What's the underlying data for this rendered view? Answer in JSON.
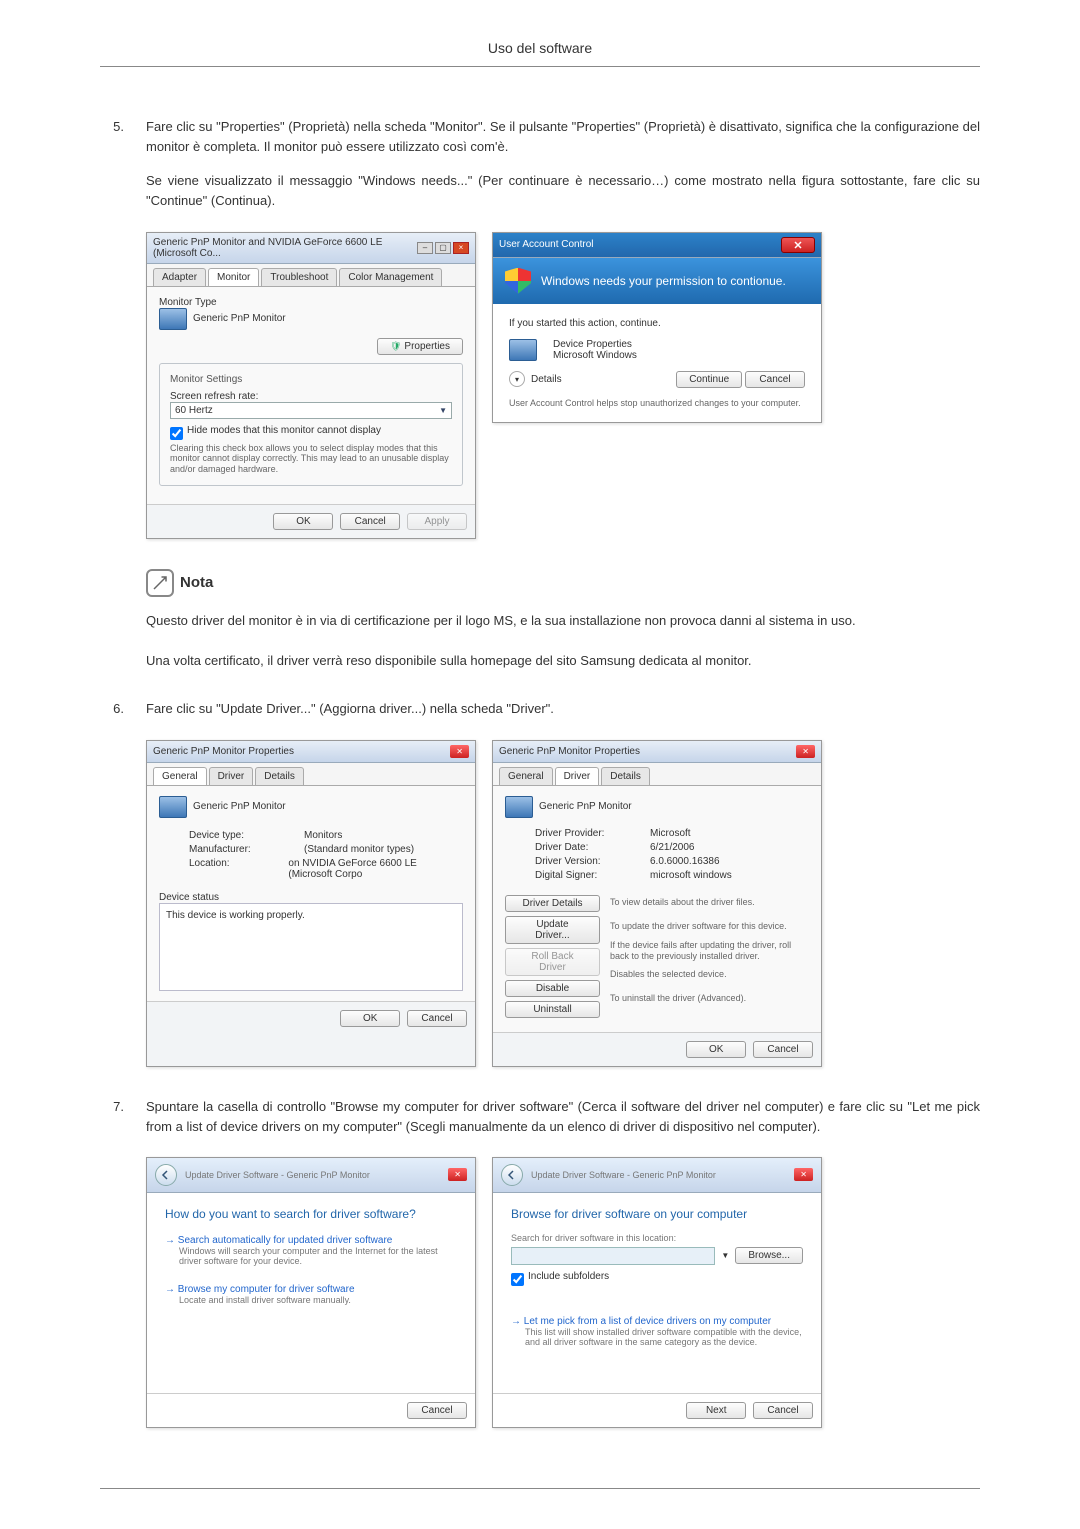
{
  "header": {
    "title": "Uso del software"
  },
  "steps": {
    "s5": {
      "num": "5.",
      "p1": "Fare clic su \"Properties\" (Proprietà) nella scheda \"Monitor\". Se il pulsante \"Properties\" (Proprietà) è disattivato, significa che la configurazione del monitor è completa. Il monitor può essere utilizzato così com'è.",
      "p2": "Se viene visualizzato il messaggio \"Windows needs...\" (Per continuare è necessario…) come mostrato nella figura sottostante, fare clic su \"Continue\" (Continua)."
    },
    "s6": {
      "num": "6.",
      "p1": "Fare clic su \"Update Driver...\" (Aggiorna driver...) nella scheda \"Driver\"."
    },
    "s7": {
      "num": "7.",
      "p1": "Spuntare la casella di controllo \"Browse my computer for driver software\" (Cerca il software del driver nel computer) e fare clic su \"Let me pick from a list of device drivers on my computer\" (Scegli manualmente da un elenco di driver di dispositivo nel computer)."
    }
  },
  "note": {
    "label": "Nota",
    "p1": "Questo driver del monitor è in via di certificazione per il logo MS, e la sua installazione non provoca danni al sistema in uso.",
    "p2": "Una volta certificato, il driver verrà reso disponibile sulla homepage del sito Samsung dedicata al monitor."
  },
  "win5a": {
    "title": "Generic PnP Monitor and NVIDIA GeForce 6600 LE (Microsoft Co...",
    "tabs": [
      "Adapter",
      "Monitor",
      "Troubleshoot",
      "Color Management"
    ],
    "monitorType": "Monitor Type",
    "monitorName": "Generic PnP Monitor",
    "properties": "Properties",
    "settings": "Monitor Settings",
    "refreshLabel": "Screen refresh rate:",
    "refreshValue": "60 Hertz",
    "hide": "Hide modes that this monitor cannot display",
    "hideHelp": "Clearing this check box allows you to select display modes that this monitor cannot display correctly. This may lead to an unusable display and/or damaged hardware.",
    "ok": "OK",
    "cancel": "Cancel",
    "apply": "Apply"
  },
  "uac": {
    "title": "User Account Control",
    "message": "Windows needs your permission to contionue.",
    "started": "If you started this action, continue.",
    "devProps": "Device Properties",
    "msWin": "Microsoft Windows",
    "details": "Details",
    "continue": "Continue",
    "cancel": "Cancel",
    "footer": "User Account Control helps stop unauthorized changes to your computer."
  },
  "win6a": {
    "title": "Generic PnP Monitor Properties",
    "tabs": [
      "General",
      "Driver",
      "Details"
    ],
    "name": "Generic PnP Monitor",
    "rows": {
      "devType": {
        "k": "Device type:",
        "v": "Monitors"
      },
      "mfr": {
        "k": "Manufacturer:",
        "v": "(Standard monitor types)"
      },
      "loc": {
        "k": "Location:",
        "v": "on NVIDIA GeForce 6600 LE (Microsoft Corpo"
      }
    },
    "statusLabel": "Device status",
    "statusText": "This device is working properly.",
    "ok": "OK",
    "cancel": "Cancel"
  },
  "win6b": {
    "title": "Generic PnP Monitor Properties",
    "tabs": [
      "General",
      "Driver",
      "Details"
    ],
    "name": "Generic PnP Monitor",
    "rows": {
      "provider": {
        "k": "Driver Provider:",
        "v": "Microsoft"
      },
      "date": {
        "k": "Driver Date:",
        "v": "6/21/2006"
      },
      "version": {
        "k": "Driver Version:",
        "v": "6.0.6000.16386"
      },
      "signer": {
        "k": "Digital Signer:",
        "v": "microsoft windows"
      }
    },
    "btns": {
      "details": {
        "label": "Driver Details",
        "desc": "To view details about the driver files."
      },
      "update": {
        "label": "Update Driver...",
        "desc": "To update the driver software for this device."
      },
      "rollback": {
        "label": "Roll Back Driver",
        "desc": "If the device fails after updating the driver, roll back to the previously installed driver."
      },
      "disable": {
        "label": "Disable",
        "desc": "Disables the selected device."
      },
      "uninstall": {
        "label": "Uninstall",
        "desc": "To uninstall the driver (Advanced)."
      }
    },
    "ok": "OK",
    "cancel": "Cancel"
  },
  "wiz7a": {
    "crumb": "Update Driver Software - Generic PnP Monitor",
    "heading": "How do you want to search for driver software?",
    "opt1": "Search automatically for updated driver software",
    "opt1d": "Windows will search your computer and the Internet for the latest driver software for your device.",
    "opt2": "Browse my computer for driver software",
    "opt2d": "Locate and install driver software manually.",
    "cancel": "Cancel"
  },
  "wiz7b": {
    "crumb": "Update Driver Software - Generic PnP Monitor",
    "heading": "Browse for driver software on your computer",
    "searchLabel": "Search for driver software in this location:",
    "browse": "Browse...",
    "include": "Include subfolders",
    "pick": "Let me pick from a list of device drivers on my computer",
    "pickd": "This list will show installed driver software compatible with the device, and all driver software in the same category as the device.",
    "next": "Next",
    "cancel": "Cancel"
  }
}
